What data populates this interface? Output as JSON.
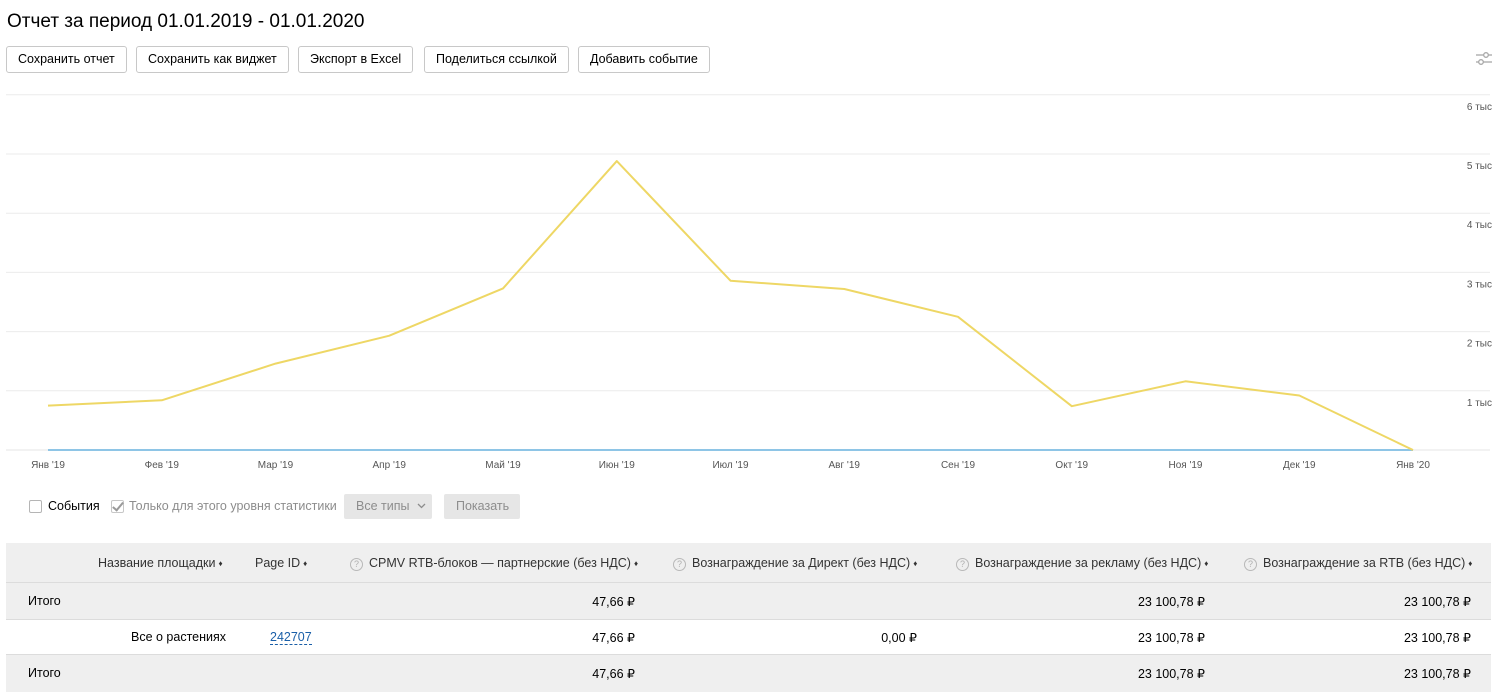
{
  "page": {
    "title": "Отчет за период 01.01.2019 - 01.01.2020"
  },
  "toolbar": {
    "save_report": "Сохранить отчет",
    "save_widget": "Сохранить как виджет",
    "export_excel": "Экспорт в Excel",
    "share_link": "Поделиться ссылкой",
    "add_event": "Добавить событие"
  },
  "chart_data": {
    "type": "line",
    "x": [
      "Янв '19",
      "Фев '19",
      "Мар '19",
      "Апр '19",
      "Май '19",
      "Июн '19",
      "Июл '19",
      "Авг '19",
      "Сен '19",
      "Окт '19",
      "Ноя '19",
      "Дек '19",
      "Янв '20"
    ],
    "series": [
      {
        "color": "#eed765",
        "values": [
          750,
          840,
          1460,
          1930,
          2730,
          4880,
          2860,
          2720,
          2250,
          740,
          1160,
          920,
          0
        ]
      },
      {
        "color": "#8ec5e6",
        "values": [
          0,
          0,
          0,
          0,
          0,
          0,
          0,
          0,
          0,
          0,
          0,
          0,
          0
        ]
      }
    ],
    "ylim": [
      0,
      6000
    ],
    "yticks": [
      {
        "value": 1000,
        "label": "1 тыс"
      },
      {
        "value": 2000,
        "label": "2 тыс"
      },
      {
        "value": 3000,
        "label": "3 тыс"
      },
      {
        "value": 4000,
        "label": "4 тыс"
      },
      {
        "value": 5000,
        "label": "5 тыс"
      },
      {
        "value": 6000,
        "label": "6 тыс"
      }
    ],
    "grid": true,
    "yaxis_side": "right"
  },
  "filters": {
    "events_label": "События",
    "events_checked": false,
    "level_only_label": "Только для этого уровня статистики",
    "level_only_checked": true,
    "types_select": "Все типы",
    "show_button": "Показать"
  },
  "table": {
    "headers": {
      "site_name": "Название площадки",
      "page_id": "Page ID",
      "cpmv": "CPMV RTB-блоков — партнерские (без НДС)",
      "direct": "Вознаграждение за Директ (без НДС)",
      "ads": "Вознаграждение за рекламу (без НДС)",
      "rtb": "Вознаграждение за RTB (без НДС)"
    },
    "sort_glyph": "♦",
    "help_glyph": "?",
    "total_top": {
      "label": "Итого",
      "cpmv": "47,66 ₽",
      "ads": "23 100,78 ₽",
      "rtb": "23 100,78 ₽"
    },
    "row": {
      "site_name": "Все о растениях",
      "page_id": "242707",
      "cpmv": "47,66 ₽",
      "direct": "0,00 ₽",
      "ads": "23 100,78 ₽",
      "rtb": "23 100,78 ₽"
    },
    "total_bottom": {
      "label": "Итого",
      "cpmv": "47,66 ₽",
      "ads": "23 100,78 ₽",
      "rtb": "23 100,78 ₽"
    }
  }
}
